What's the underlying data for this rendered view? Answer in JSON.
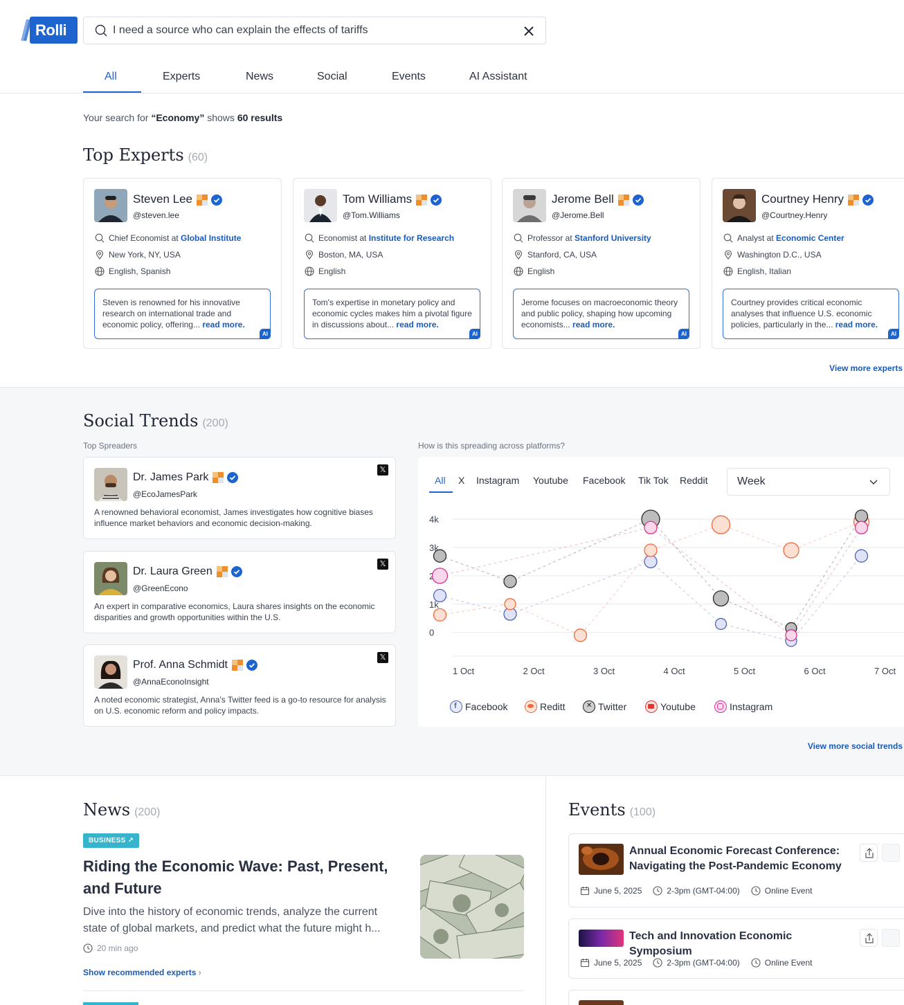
{
  "brand": {
    "logo_text": "Rolli",
    "primary_color": "#1d64cf"
  },
  "search": {
    "value": "I need a source who can explain the effects of tariffs",
    "placeholder": "Search"
  },
  "tabs": [
    {
      "label": "All",
      "active": true
    },
    {
      "label": "Experts"
    },
    {
      "label": "News"
    },
    {
      "label": "Social"
    },
    {
      "label": "Events"
    },
    {
      "label": "AI Assistant"
    }
  ],
  "summary": {
    "prefix": "Your search for ",
    "term": "“Economy”",
    "middle": " shows ",
    "results": "60 results"
  },
  "experts": {
    "title": "Top Experts",
    "count": "(60)",
    "view_more": "View more experts",
    "cards": [
      {
        "name": "Steven Lee",
        "handle": "@steven.lee",
        "role_prefix": "Chief Economist at ",
        "org": "Global Institute",
        "location": "New York, NY, USA",
        "languages": "English, Spanish",
        "bio": "Steven is renowned for his innovative research on international trade and economic policy, offering...",
        "read_more": "read more."
      },
      {
        "name": "Tom Williams",
        "handle": "@Tom.Williams",
        "role_prefix": "Economist at ",
        "org": "Institute for Research",
        "location": "Boston, MA, USA",
        "languages": "English",
        "bio": "Tom's expertise in monetary policy and economic cycles makes him a pivotal figure in discussions about...",
        "read_more": "read more."
      },
      {
        "name": "Jerome Bell",
        "handle": "@Jerome.Bell",
        "role_prefix": "Professor at ",
        "org": "Stanford University",
        "location": "Stanford, CA, USA",
        "languages": "English",
        "bio": "Jerome focuses on macroeconomic theory and public policy, shaping how upcoming economists...",
        "read_more": "read more."
      },
      {
        "name": "Courtney Henry",
        "handle": "@Courtney.Henry",
        "role_prefix": "Analyst at ",
        "org": "Economic Center",
        "location": "Washington D.C., USA",
        "languages": "English, Italian",
        "bio": "Courtney provides critical economic analyses that influence U.S. economic policies, particularly in the...",
        "read_more": "read more."
      }
    ],
    "ai_badge": "AI"
  },
  "social": {
    "title": "Social Trends",
    "count": "(200)",
    "spreaders_label": "Top Spreaders",
    "chart_label": "How is this spreading across platforms?",
    "view_more": "View more social trends",
    "spreaders": [
      {
        "name": "Dr. James Park",
        "handle": "@EcoJamesPark",
        "desc": "A renowned behavioral economist, James investigates how cognitive biases influence market behaviors and economic decision-making."
      },
      {
        "name": "Dr. Laura Green",
        "handle": "@GreenEcono",
        "desc": "An expert in comparative economics, Laura shares insights on the economic disparities and growth opportunities within the U.S."
      },
      {
        "name": "Prof. Anna Schmidt",
        "handle": "@AnnaEconoInsight",
        "desc": "A noted economic strategist, Anna's Twitter feed is a go-to resource for analysis on U.S. economic reform and policy impacts."
      }
    ],
    "x_glyph": "𝕏",
    "platform_tabs": [
      "All",
      "X",
      "Instagram",
      "Youtube",
      "Facebook",
      "Tik Tok",
      "Reddit"
    ],
    "period": "Week"
  },
  "chart_data": {
    "type": "scatter",
    "title": "",
    "x": [
      "1 Oct",
      "2 Oct",
      "3 Oct",
      "4 Oct",
      "5 Oct",
      "6 Oct",
      "7 Oct"
    ],
    "y_ticks": [
      "4k",
      "3k",
      "2k",
      "1k",
      "0"
    ],
    "ylim": [
      0,
      4000
    ],
    "grid": true,
    "legend_position": "bottom",
    "series": [
      {
        "name": "Facebook",
        "color": "#4f63b8",
        "values": [
          1300,
          650,
          null,
          2500,
          300,
          -300,
          2700
        ]
      },
      {
        "name": "Reditt",
        "color": "#ee6a3c",
        "values": [
          620,
          1000,
          -100,
          2900,
          3800,
          2900,
          3900
        ]
      },
      {
        "name": "Twitter",
        "color": "#2a2a2a",
        "values": [
          2700,
          1800,
          null,
          4000,
          1200,
          150,
          4100
        ]
      },
      {
        "name": "Youtube",
        "color": "#e2362e",
        "values": [
          null,
          null,
          null,
          null,
          null,
          null,
          null
        ]
      },
      {
        "name": "Instagram",
        "color": "#d6338f",
        "values": [
          2000,
          null,
          null,
          3700,
          null,
          -100,
          3700
        ]
      }
    ],
    "legend": [
      "Facebook",
      "Reditt",
      "Twitter",
      "Youtube",
      "Instagram"
    ]
  },
  "news": {
    "title": "News",
    "count": "(200)",
    "tag": "BUSINESS",
    "headline": "Riding the Economic Wave: Past, Present, and Future",
    "summary": "Dive into the history of economic trends, analyze the current state of global markets, and predict what the future might h...",
    "time": "20 min ago",
    "link": "Show recommended experts"
  },
  "events": {
    "title": "Events",
    "count": "(100)",
    "items": [
      {
        "title": "Annual Economic Forecast Conference: Navigating the Post-Pandemic Economy",
        "date": "June 5, 2025",
        "time": "2-3pm (GMT-04:00)",
        "mode": "Online Event"
      },
      {
        "title": "Tech and Innovation Economic Symposium",
        "date": "June 5, 2025",
        "time": "2-3pm (GMT-04:00)",
        "mode": "Online Event"
      }
    ]
  }
}
